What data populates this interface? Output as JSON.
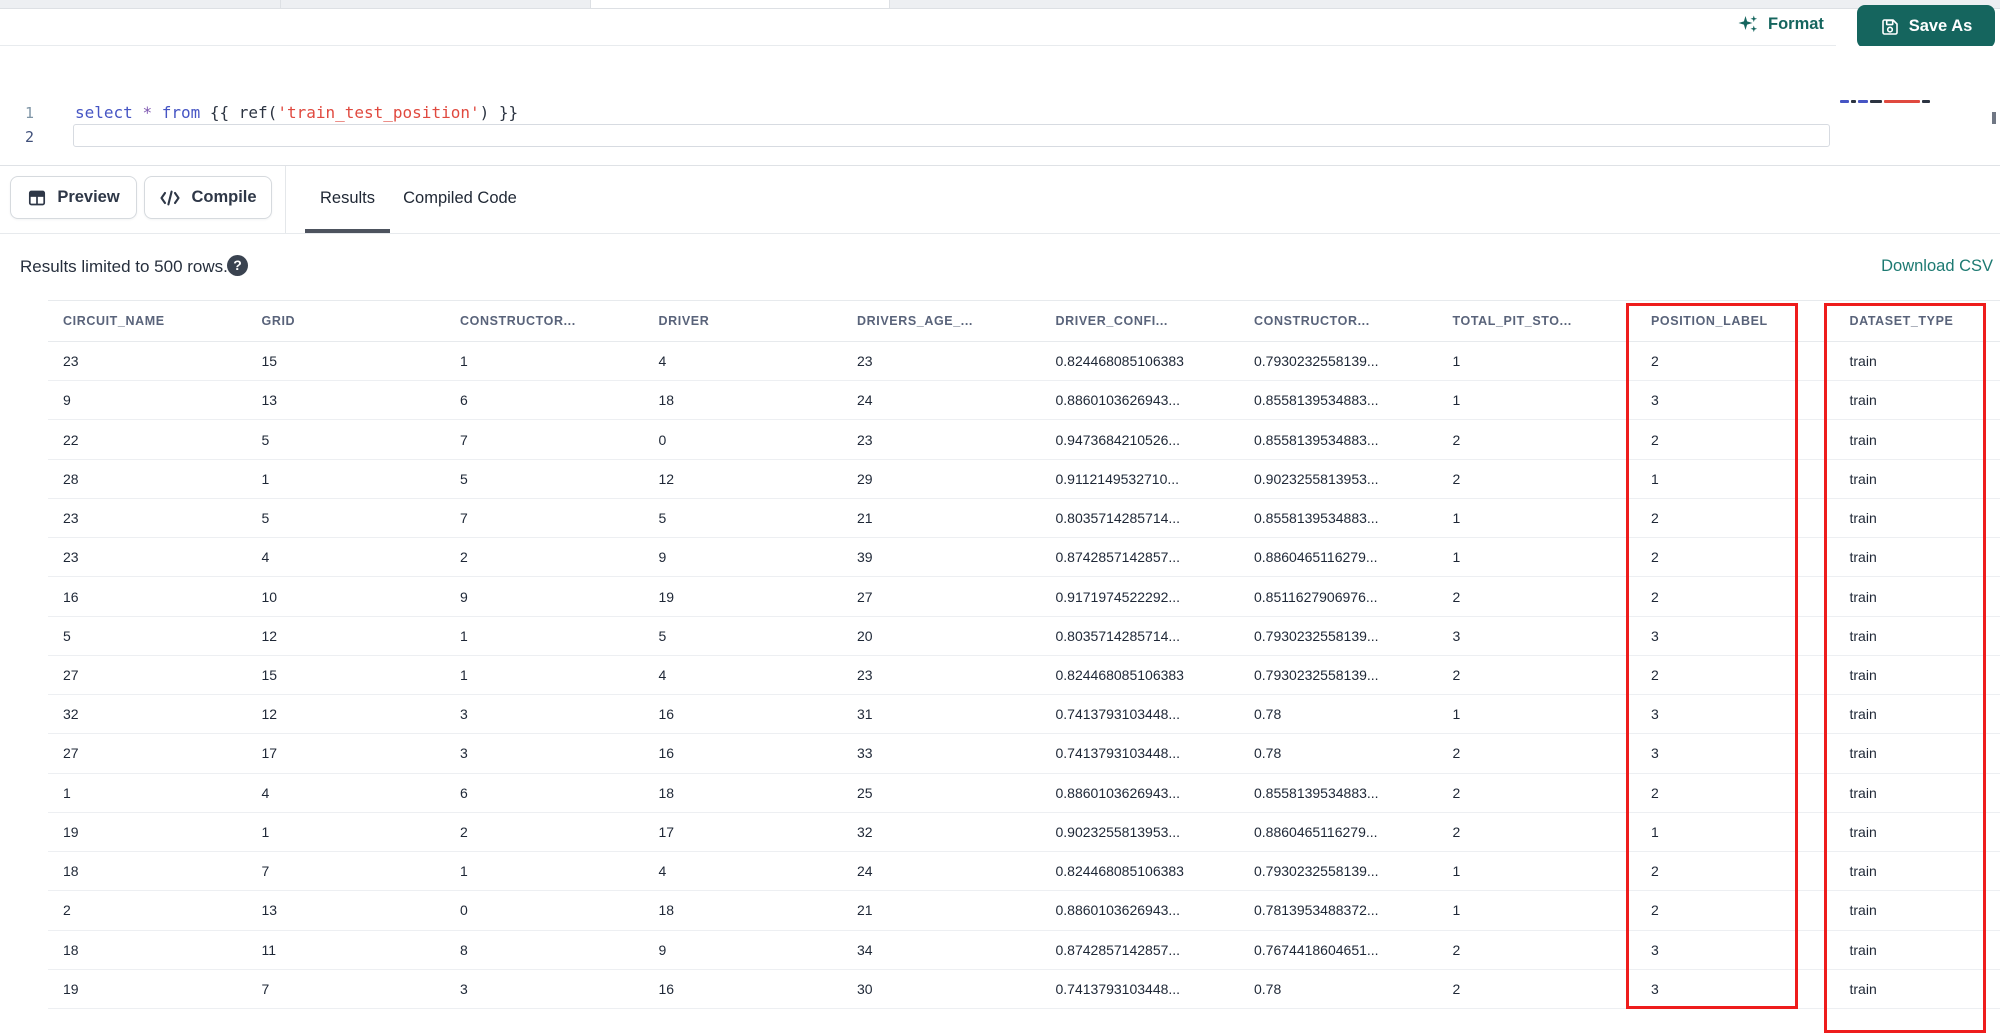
{
  "colors": {
    "accent_teal": "#15655e",
    "link_teal": "#1d7a72",
    "highlight_red": "#ee1c1c"
  },
  "editor": {
    "toolbar": {
      "format_label": "Format",
      "save_as_label": "Save As"
    },
    "line_numbers": [
      "1",
      "2"
    ],
    "code_tokens": [
      {
        "type": "keyword",
        "text": "select"
      },
      {
        "type": "plain",
        "text": " "
      },
      {
        "type": "operator",
        "text": "*"
      },
      {
        "type": "plain",
        "text": " "
      },
      {
        "type": "keyword",
        "text": "from"
      },
      {
        "type": "plain",
        "text": " {{ ref("
      },
      {
        "type": "string",
        "text": "'train_test_position'"
      },
      {
        "type": "plain",
        "text": ") }}"
      }
    ]
  },
  "results_panel": {
    "preview_label": "Preview",
    "compile_label": "Compile",
    "tabs": [
      {
        "label": "Results",
        "active": true
      },
      {
        "label": "Compiled Code",
        "active": false
      }
    ],
    "limit_notice": "Results limited to 500 rows.",
    "help_glyph": "?",
    "download_label": "Download CSV"
  },
  "table": {
    "columns": [
      "CIRCUIT_NAME",
      "GRID",
      "CONSTRUCTOR...",
      "DRIVER",
      "DRIVERS_AGE_...",
      "DRIVER_CONFI...",
      "CONSTRUCTOR...",
      "TOTAL_PIT_STO...",
      "POSITION_LABEL",
      "DATASET_TYPE"
    ],
    "rows": [
      [
        "23",
        "15",
        "1",
        "4",
        "23",
        "0.824468085106383",
        "0.7930232558139...",
        "1",
        "2",
        "train"
      ],
      [
        "9",
        "13",
        "6",
        "18",
        "24",
        "0.8860103626943...",
        "0.8558139534883...",
        "1",
        "3",
        "train"
      ],
      [
        "22",
        "5",
        "7",
        "0",
        "23",
        "0.9473684210526...",
        "0.8558139534883...",
        "2",
        "2",
        "train"
      ],
      [
        "28",
        "1",
        "5",
        "12",
        "29",
        "0.9112149532710...",
        "0.9023255813953...",
        "2",
        "1",
        "train"
      ],
      [
        "23",
        "5",
        "7",
        "5",
        "21",
        "0.8035714285714...",
        "0.8558139534883...",
        "1",
        "2",
        "train"
      ],
      [
        "23",
        "4",
        "2",
        "9",
        "39",
        "0.8742857142857...",
        "0.8860465116279...",
        "1",
        "2",
        "train"
      ],
      [
        "16",
        "10",
        "9",
        "19",
        "27",
        "0.9171974522292...",
        "0.8511627906976...",
        "2",
        "2",
        "train"
      ],
      [
        "5",
        "12",
        "1",
        "5",
        "20",
        "0.8035714285714...",
        "0.7930232558139...",
        "3",
        "3",
        "train"
      ],
      [
        "27",
        "15",
        "1",
        "4",
        "23",
        "0.824468085106383",
        "0.7930232558139...",
        "2",
        "2",
        "train"
      ],
      [
        "32",
        "12",
        "3",
        "16",
        "31",
        "0.7413793103448...",
        "0.78",
        "1",
        "3",
        "train"
      ],
      [
        "27",
        "17",
        "3",
        "16",
        "33",
        "0.7413793103448...",
        "0.78",
        "2",
        "3",
        "train"
      ],
      [
        "1",
        "4",
        "6",
        "18",
        "25",
        "0.8860103626943...",
        "0.8558139534883...",
        "2",
        "2",
        "train"
      ],
      [
        "19",
        "1",
        "2",
        "17",
        "32",
        "0.9023255813953...",
        "0.8860465116279...",
        "2",
        "1",
        "train"
      ],
      [
        "18",
        "7",
        "1",
        "4",
        "24",
        "0.824468085106383",
        "0.7930232558139...",
        "1",
        "2",
        "train"
      ],
      [
        "2",
        "13",
        "0",
        "18",
        "21",
        "0.8860103626943...",
        "0.7813953488372...",
        "1",
        "2",
        "train"
      ],
      [
        "18",
        "11",
        "8",
        "9",
        "34",
        "0.8742857142857...",
        "0.7674418604651...",
        "2",
        "3",
        "train"
      ],
      [
        "19",
        "7",
        "3",
        "16",
        "30",
        "0.7413793103448...",
        "0.78",
        "2",
        "3",
        "train"
      ]
    ]
  }
}
